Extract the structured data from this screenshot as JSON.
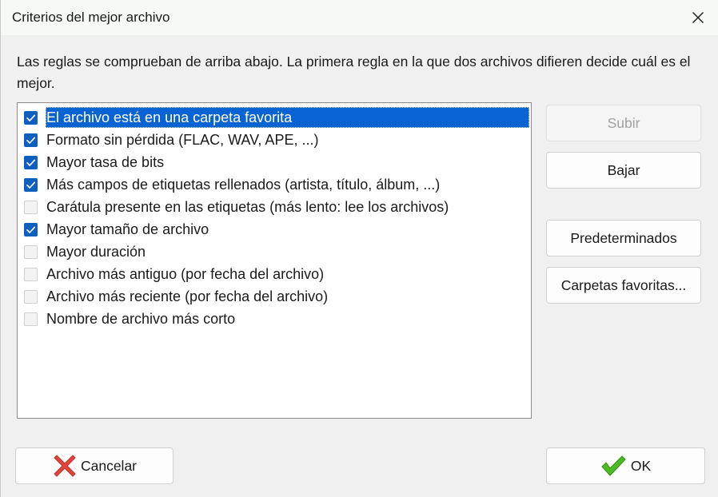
{
  "window": {
    "title": "Criterios del mejor archivo"
  },
  "description": "Las reglas se comprueban de arriba abajo. La primera regla en la que dos archivos difieren decide cuál es el mejor.",
  "rules": [
    {
      "label": "El archivo está en una carpeta favorita",
      "checked": true,
      "selected": true
    },
    {
      "label": "Formato sin pérdida (FLAC, WAV, APE, ...)",
      "checked": true,
      "selected": false
    },
    {
      "label": "Mayor tasa de bits",
      "checked": true,
      "selected": false
    },
    {
      "label": "Más campos de etiquetas rellenados (artista, título, álbum, ...)",
      "checked": true,
      "selected": false
    },
    {
      "label": "Carátula presente en las etiquetas (más lento: lee los archivos)",
      "checked": false,
      "selected": false
    },
    {
      "label": "Mayor tamaño de archivo",
      "checked": true,
      "selected": false
    },
    {
      "label": "Mayor duración",
      "checked": false,
      "selected": false
    },
    {
      "label": "Archivo más antiguo (por fecha del archivo)",
      "checked": false,
      "selected": false
    },
    {
      "label": "Archivo más reciente (por fecha del archivo)",
      "checked": false,
      "selected": false
    },
    {
      "label": "Nombre de archivo más corto",
      "checked": false,
      "selected": false
    }
  ],
  "buttons": {
    "up": "Subir",
    "down": "Bajar",
    "defaults": "Predeterminados",
    "favorite_folders": "Carpetas favoritas...",
    "cancel": "Cancelar",
    "ok": "OK"
  },
  "colors": {
    "selection": "#0a63d2",
    "checkbox_on": "#0f5fc0",
    "cancel_icon": "#e0463c",
    "ok_icon": "#3fae1e"
  }
}
